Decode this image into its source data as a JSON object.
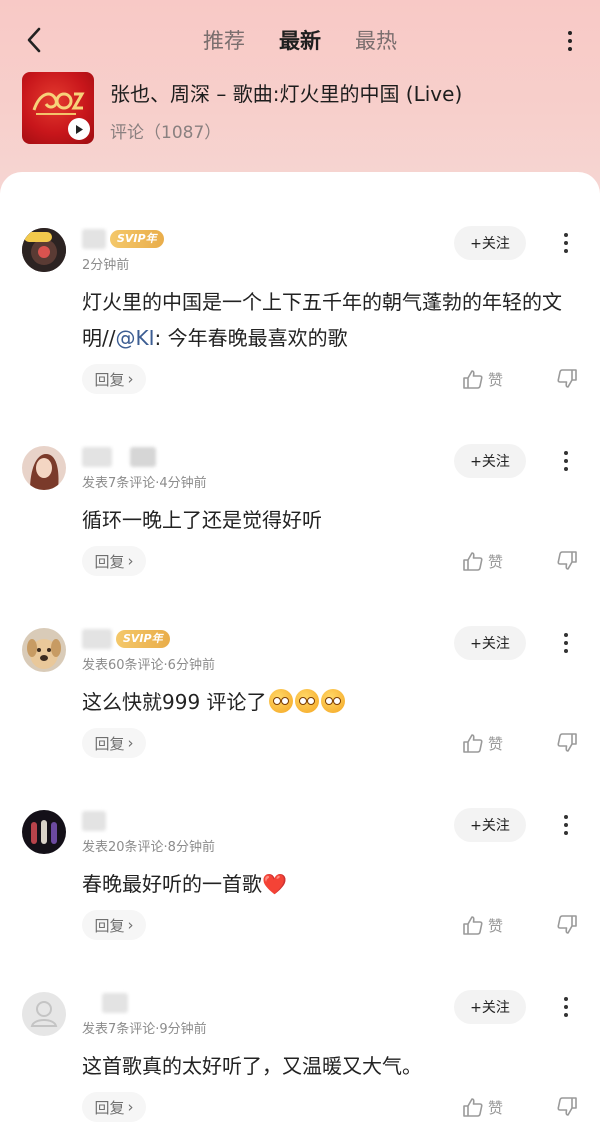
{
  "header": {
    "tabs": [
      {
        "label": "推荐",
        "active": false
      },
      {
        "label": "最新",
        "active": true
      },
      {
        "label": "最热",
        "active": false
      }
    ]
  },
  "song": {
    "title": "张也、周深 – 歌曲:灯火里的中国 (Live)",
    "comment_label": "评论",
    "comment_count": "（1087）"
  },
  "actions": {
    "follow_label": "+关注",
    "reply_label": "回复",
    "reply_chevron": "›",
    "like_label": "赞"
  },
  "colors": {
    "header_bg": "#f8c9c6",
    "cover_red": "#c8161b",
    "svip_gold": "#e9ad4a",
    "mention_blue": "#3c5d92"
  },
  "comments": [
    {
      "svip_label": "SVIP年",
      "meta": "2分钟前",
      "text_before": "灯火里的中国是一个上下五千年的朝气蓬勃的年轻的文明//",
      "mention": "@KI",
      "text_after": ": 今年春晚最喜欢的歌"
    },
    {
      "meta": "发表7条评论·4分钟前",
      "text": "循环一晚上了还是觉得好听"
    },
    {
      "svip_label": "SVIP年",
      "meta": "发表60条评论·6分钟前",
      "text": "这么快就999 评论了"
    },
    {
      "meta": "发表20条评论·8分钟前",
      "text": "春晚最好听的一首歌❤️"
    },
    {
      "meta": "发表7条评论·9分钟前",
      "text": "这首歌真的太好听了，又温暖又大气。"
    }
  ]
}
